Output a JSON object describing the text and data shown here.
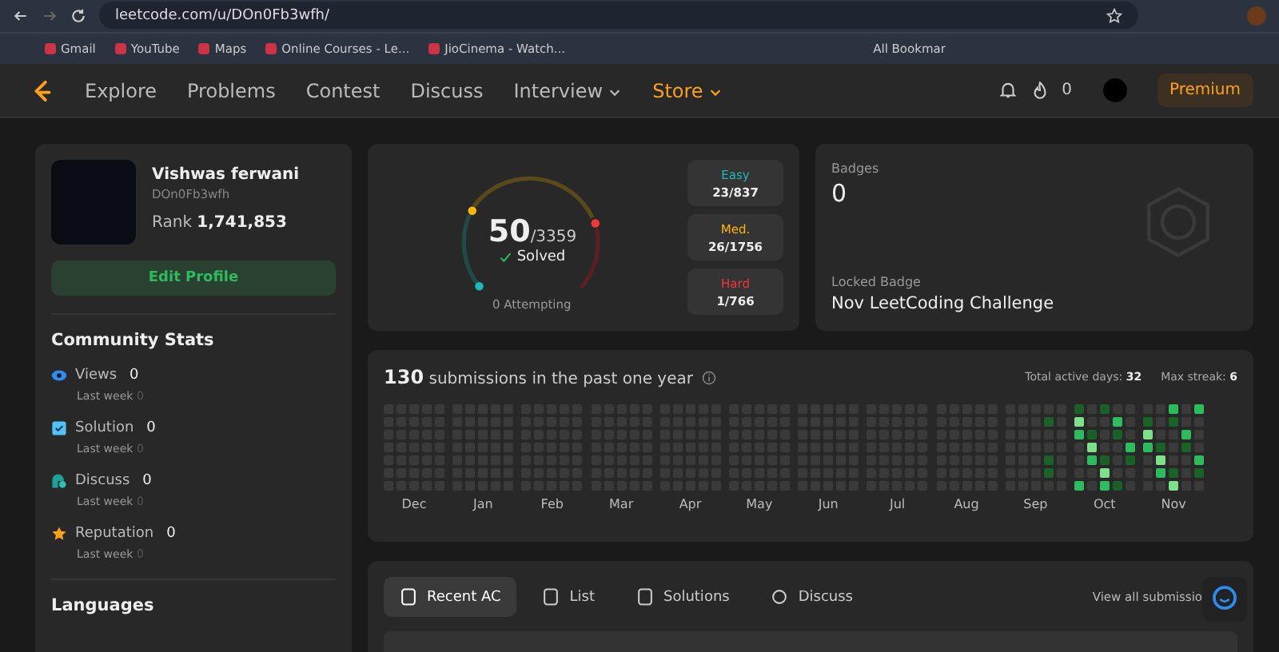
{
  "browser": {
    "url": "leetcode.com/u/DOn0Fb3wfh/",
    "bookmarks": [
      "Gmail",
      "YouTube",
      "Maps",
      "Online Courses - Le...",
      "JioCinema - Watch..."
    ],
    "all_bookmarks": "All Bookmar"
  },
  "nav": {
    "items": [
      {
        "label": "Explore",
        "dropdown": false,
        "accent": false
      },
      {
        "label": "Problems",
        "dropdown": false,
        "accent": false
      },
      {
        "label": "Contest",
        "dropdown": false,
        "accent": false
      },
      {
        "label": "Discuss",
        "dropdown": false,
        "accent": false
      },
      {
        "label": "Interview",
        "dropdown": true,
        "accent": false
      },
      {
        "label": "Store",
        "dropdown": true,
        "accent": true
      }
    ],
    "streak": "0",
    "premium": "Premium"
  },
  "profile": {
    "name": "Vishwas ferwani",
    "username": "DOn0Fb3wfh",
    "rank_label": "Rank",
    "rank": "1,741,853",
    "edit": "Edit Profile"
  },
  "community": {
    "title": "Community Stats",
    "stats": [
      {
        "kind": "views",
        "label": "Views",
        "value": "0",
        "sub": "Last week",
        "sub_value": "0"
      },
      {
        "kind": "solution",
        "label": "Solution",
        "value": "0",
        "sub": "Last week",
        "sub_value": "0"
      },
      {
        "kind": "discuss",
        "label": "Discuss",
        "value": "0",
        "sub": "Last week",
        "sub_value": "0"
      },
      {
        "kind": "reputation",
        "label": "Reputation",
        "value": "0",
        "sub": "Last week",
        "sub_value": "0"
      }
    ]
  },
  "languages": {
    "title": "Languages"
  },
  "solved": {
    "count": "50",
    "total": "/3359",
    "label": "Solved",
    "attempting": "0 Attempting",
    "levels": [
      {
        "label": "Easy",
        "value": "23/837",
        "color": "#1cbaba"
      },
      {
        "label": "Med.",
        "value": "26/1756",
        "color": "#ffb700"
      },
      {
        "label": "Hard",
        "value": "1/766",
        "color": "#f63737"
      }
    ]
  },
  "badges": {
    "title": "Badges",
    "count": "0",
    "locked_label": "Locked Badge",
    "locked_name": "Nov LeetCoding Challenge"
  },
  "submissions": {
    "count": "130",
    "text": "submissions in the past one year",
    "active_label": "Total active days:",
    "active": "32",
    "streak_label": "Max streak:",
    "streak": "6",
    "months": [
      "Dec",
      "Jan",
      "Feb",
      "Mar",
      "Apr",
      "May",
      "Jun",
      "Jul",
      "Aug",
      "Sep",
      "Oct",
      "Nov"
    ]
  },
  "tabs": [
    {
      "kind": "recent",
      "label": "Recent AC",
      "selected": true
    },
    {
      "kind": "list",
      "label": "List",
      "selected": false
    },
    {
      "kind": "solutions",
      "label": "Solutions",
      "selected": false
    },
    {
      "kind": "discuss",
      "label": "Discuss",
      "selected": false
    }
  ],
  "view_all": "View all submissio"
}
